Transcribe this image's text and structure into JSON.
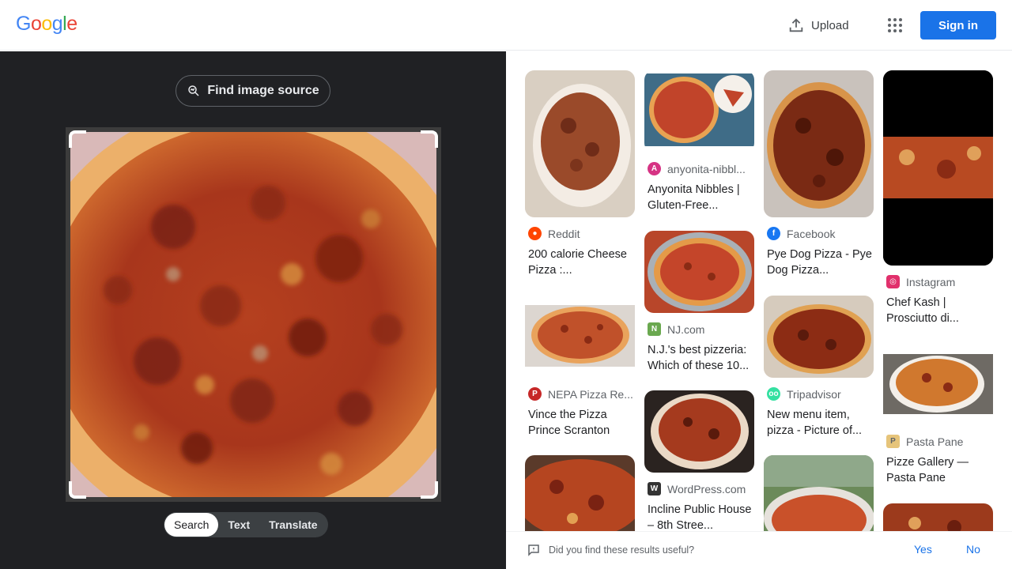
{
  "header": {
    "logo_letters": [
      "G",
      "o",
      "o",
      "g",
      "l",
      "e"
    ],
    "logo_colors": [
      "#4285F4",
      "#EA4335",
      "#FBBC05",
      "#4285F4",
      "#34A853",
      "#EA4335"
    ],
    "upload_label": "Upload",
    "signin_label": "Sign in"
  },
  "left": {
    "find_source_label": "Find image source",
    "tabs": [
      {
        "label": "Search",
        "active": true
      },
      {
        "label": "Text",
        "active": false
      },
      {
        "label": "Translate",
        "active": false
      }
    ]
  },
  "results": [
    {
      "source": "Reddit",
      "icon": "reddit-icon",
      "icon_color": "#FF4500",
      "title": "200 calorie Cheese Pizza :..."
    },
    {
      "source": "anyonita-nibbl...",
      "icon": "anyonita-icon",
      "icon_color": "#d63384",
      "title": "Anyonita Nibbles | Gluten-Free..."
    },
    {
      "source": "Facebook",
      "icon": "facebook-icon",
      "icon_color": "#1877F2",
      "title": "Pye Dog Pizza - Pye Dog Pizza..."
    },
    {
      "source": "Instagram",
      "icon": "instagram-icon",
      "icon_color": "#E1306C",
      "title": "Chef Kash | Prosciutto di..."
    },
    {
      "source": "NJ.com",
      "icon": "njcom-icon",
      "icon_color": "#6aa84f",
      "title": "N.J.'s best pizzeria: Which of these 10..."
    },
    {
      "source": "NEPA Pizza Re...",
      "icon": "nepa-pizza-icon",
      "icon_color": "#c62828",
      "title": "Vince the Pizza Prince Scranton"
    },
    {
      "source": "Tripadvisor",
      "icon": "tripadvisor-icon",
      "icon_color": "#34E0A1",
      "title": "New menu item, pizza - Picture of..."
    },
    {
      "source": "Pasta Pane",
      "icon": "pasta-pane-icon",
      "icon_color": "#e6c47a",
      "title": "Pizze Gallery — Pasta Pane"
    },
    {
      "source": "WordPress.com",
      "icon": "wordpress-icon",
      "icon_color": "#333333",
      "title": "Incline Public House – 8th Stree..."
    }
  ],
  "feedback": {
    "question": "Did you find these results useful?",
    "yes": "Yes",
    "no": "No"
  }
}
